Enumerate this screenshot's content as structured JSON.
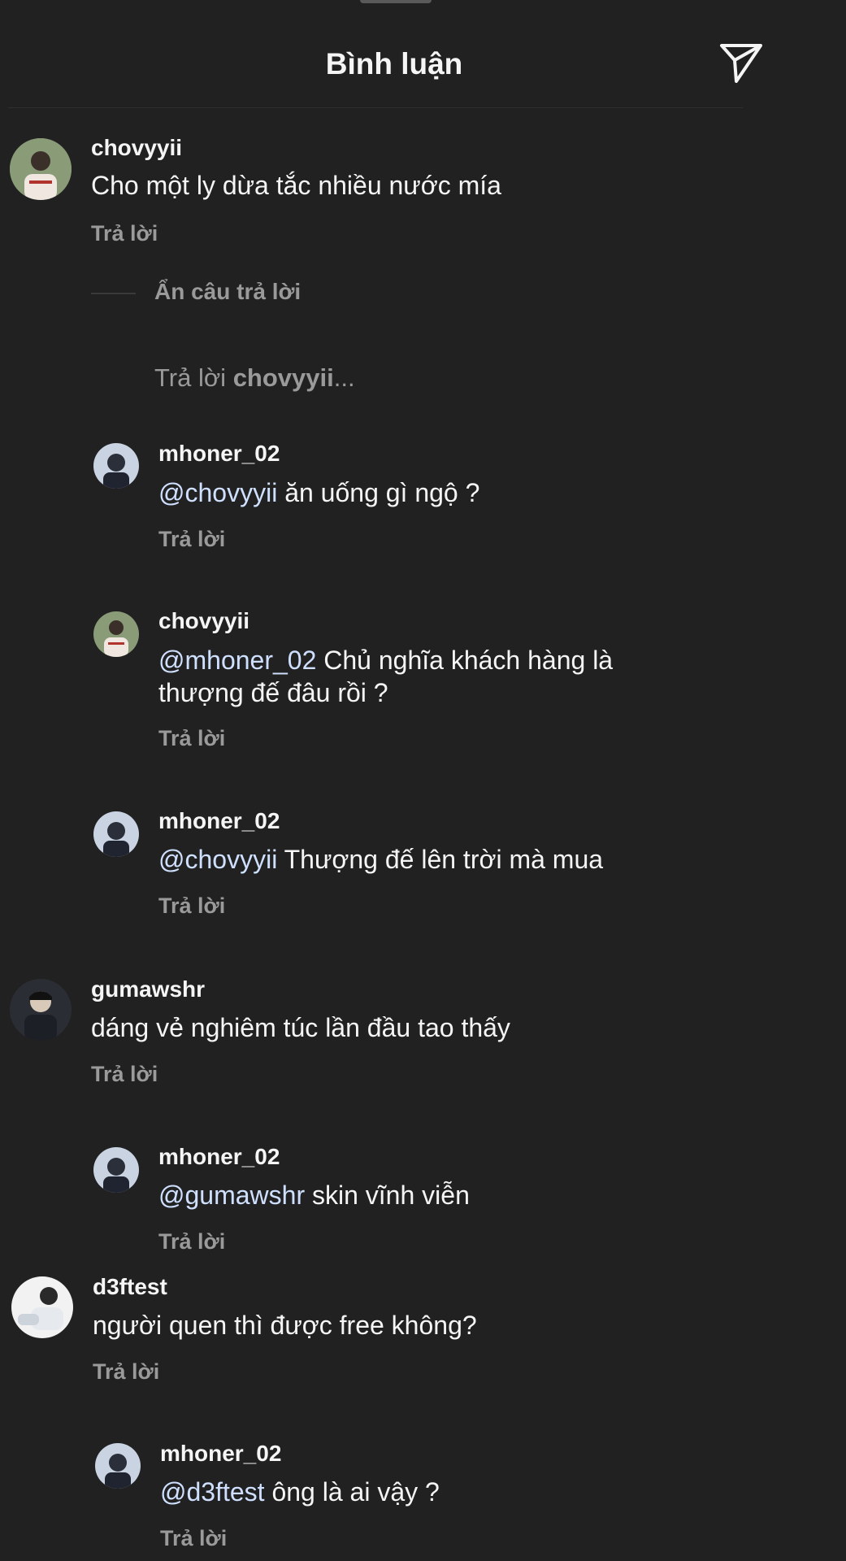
{
  "header": {
    "title": "Bình luận"
  },
  "hide_replies_label": "Ẩn câu trả lời",
  "reply_compose": {
    "prefix": "Trả lời ",
    "user": "chovyyii",
    "suffix": "..."
  },
  "comments": [
    {
      "username": "chovyyii",
      "mention": "",
      "text": "Cho một ly dừa tắc nhiều nước mía",
      "reply": "Trả lời"
    },
    {
      "username": "mhoner_02",
      "mention": "@chovyyii",
      "text": " ăn uống gì ngộ ?",
      "reply": "Trả lời"
    },
    {
      "username": "chovyyii",
      "mention": "@mhoner_02",
      "text": " Chủ nghĩa khách hàng là",
      "text2": "thượng đế đâu rồi ?",
      "reply": "Trả lời"
    },
    {
      "username": "mhoner_02",
      "mention": "@chovyyii",
      "text": " Thượng đế lên trời mà mua",
      "reply": "Trả lời"
    },
    {
      "username": "gumawshr",
      "mention": "",
      "text": "dáng vẻ nghiêm túc lần đầu tao thấy",
      "reply": "Trả lời"
    },
    {
      "username": "mhoner_02",
      "mention": "@gumawshr",
      "text": " skin vĩnh viễn",
      "reply": "Trả lời"
    },
    {
      "username": "d3ftest",
      "mention": "",
      "text": "người quen thì được free không?",
      "reply": "Trả lời"
    },
    {
      "username": "mhoner_02",
      "mention": "@d3ftest",
      "text": " ông là ai vậy ?",
      "reply": "Trả lời"
    }
  ],
  "icons": {
    "send": "send-icon",
    "avatar": "avatar"
  }
}
